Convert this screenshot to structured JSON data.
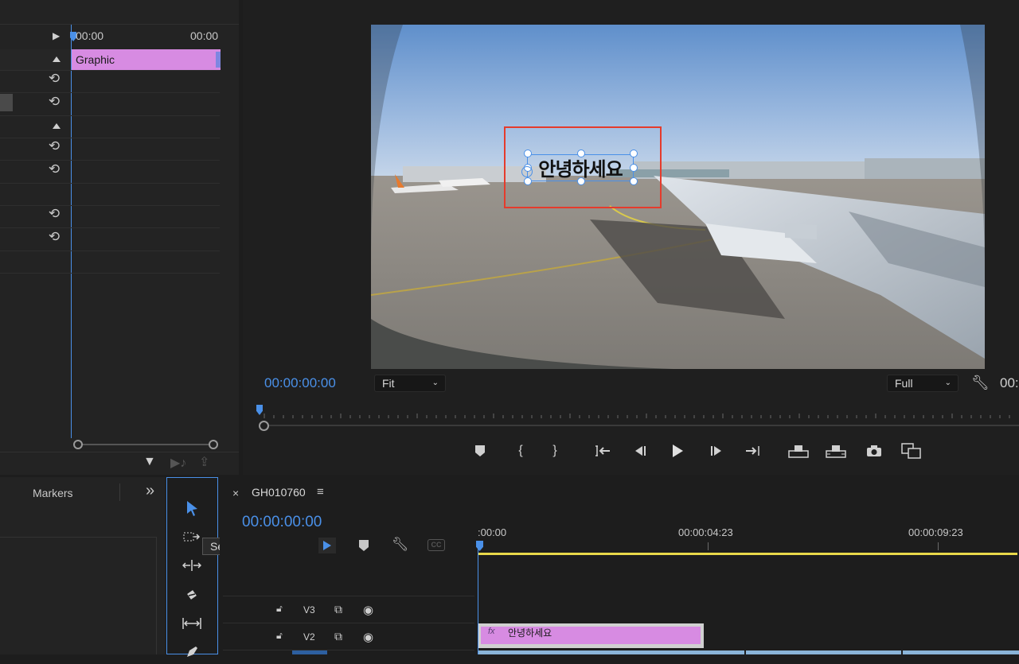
{
  "effect_controls": {
    "timecode_start": "00:00",
    "timecode_end": "00:00",
    "clip_label": "Graphic",
    "clip_color": "#d78be2"
  },
  "program": {
    "title_text": "안녕하세요",
    "timecode": "00:00:00:00",
    "fit_label": "Fit",
    "quality_label": "Full",
    "timecode_right": "00:"
  },
  "panels": {
    "markers_label": "Markers",
    "expand_label": "»"
  },
  "tooltip": "Selection Tool (V)",
  "timeline": {
    "sequence_name": "GH010760",
    "timecode": "00:00:00:00",
    "ruler_labels": [
      ":00:00",
      "00:00:04:23",
      "00:00:09:23"
    ],
    "tracks": [
      {
        "name": "V3"
      },
      {
        "name": "V2"
      }
    ],
    "clip": {
      "fx": "fx",
      "name": "안녕하세요"
    },
    "cc_label": "CC"
  },
  "colors": {
    "accent_blue": "#4a90e8",
    "clip_pink": "#d78be2",
    "selection_red": "#e53b2c",
    "work_area_yellow": "#e8d84a"
  }
}
